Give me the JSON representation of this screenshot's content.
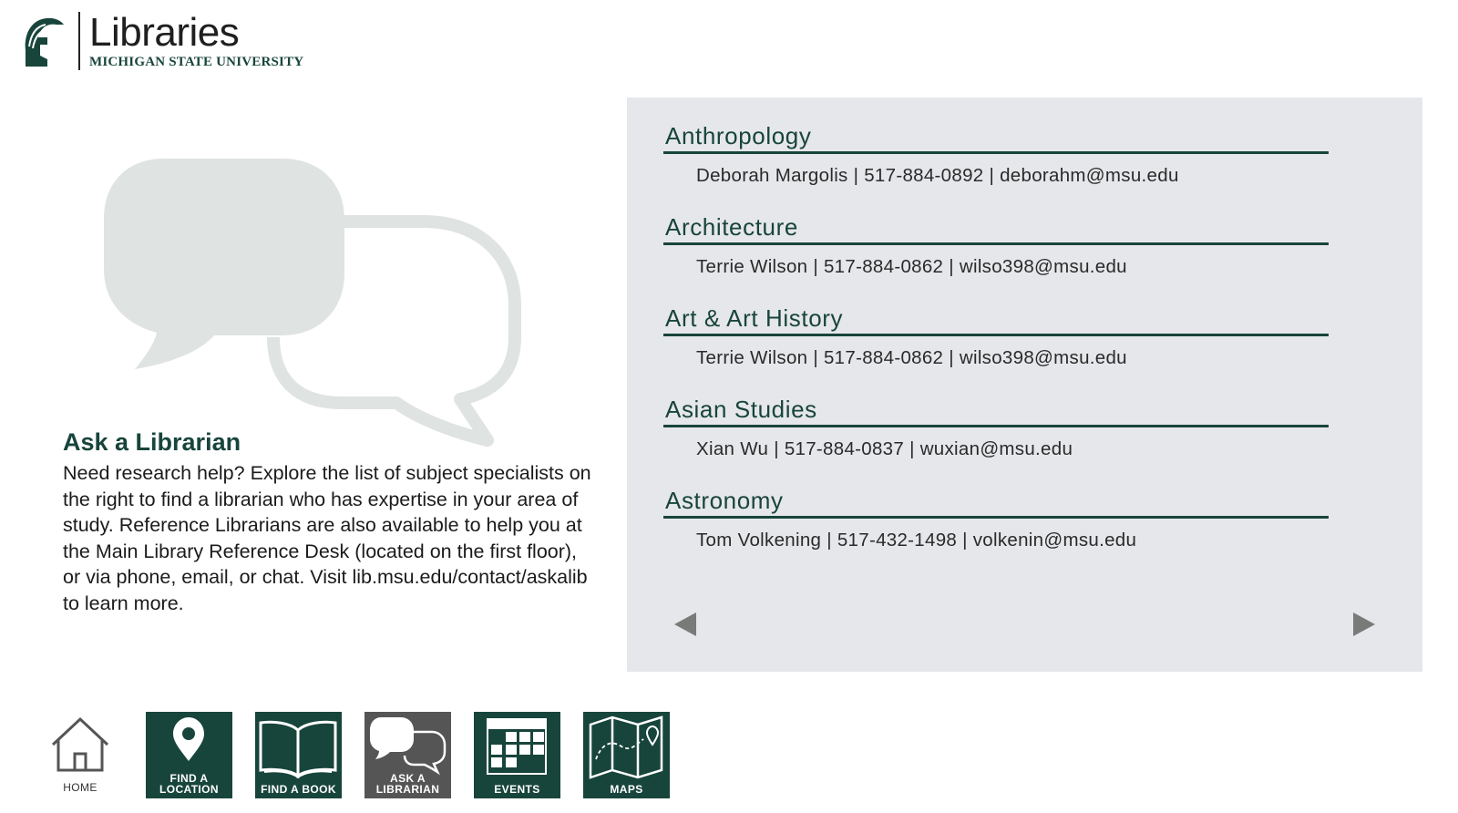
{
  "logo": {
    "name": "Libraries",
    "university": "MICHIGAN STATE UNIVERSITY"
  },
  "intro": {
    "title": "Ask a Librarian",
    "body": "Need research help? Explore the list of subject specialists on the right to find a librarian who has expertise in your area of study. Reference Librarians are also available to help you at the Main Library Reference Desk (located on the first floor), or via phone, email, or chat. Visit lib.msu.edu/contact/askalib to learn more."
  },
  "subjects": [
    {
      "heading": "Anthropology",
      "contact": "Deborah Margolis | 517-884-0892 | deborahm@msu.edu"
    },
    {
      "heading": "Architecture",
      "contact": "Terrie Wilson | 517-884-0862 | wilso398@msu.edu"
    },
    {
      "heading": "Art & Art History",
      "contact": "Terrie Wilson | 517-884-0862 | wilso398@msu.edu"
    },
    {
      "heading": "Asian Studies",
      "contact": "Xian Wu | 517-884-0837 | wuxian@msu.edu"
    },
    {
      "heading": "Astronomy",
      "contact": "Tom Volkening | 517-432-1498 | volkenin@msu.edu"
    }
  ],
  "pager": {
    "prev_icon": "triangle-left-icon",
    "next_icon": "triangle-right-icon"
  },
  "nav": {
    "home": {
      "line1": "HOME",
      "icon": "house-icon"
    },
    "find_location": {
      "line1": "FIND A",
      "line2": "LOCATION",
      "icon": "map-pin-icon"
    },
    "find_book": {
      "line1": "FIND A BOOK",
      "icon": "open-book-icon"
    },
    "ask_librarian": {
      "line1": "ASK A",
      "line2": "LIBRARIAN",
      "icon": "chat-bubbles-icon"
    },
    "events": {
      "line1": "EVENTS",
      "icon": "calendar-icon"
    },
    "maps": {
      "line1": "MAPS",
      "icon": "folded-map-icon"
    }
  },
  "colors": {
    "brand_green": "#18453b",
    "panel_bg": "#e6e7ea",
    "active_nav": "#555555",
    "bubble": "#dfe3e1"
  }
}
